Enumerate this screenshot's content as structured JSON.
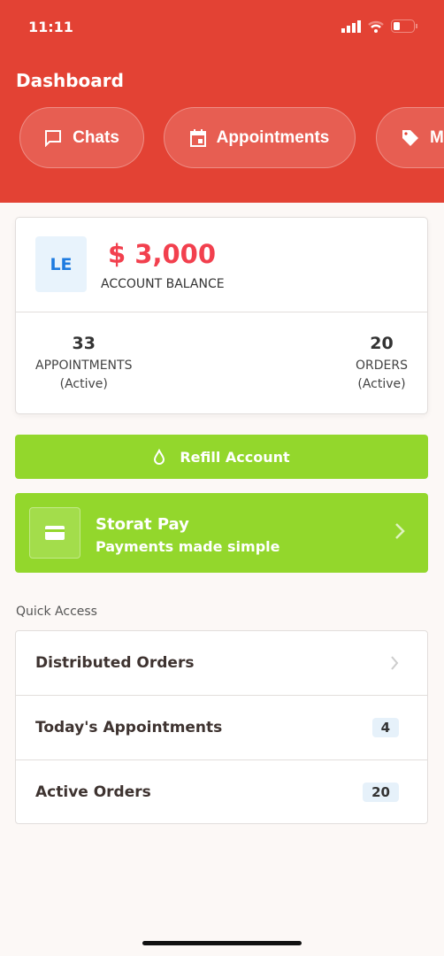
{
  "status_bar": {
    "time": "11:11"
  },
  "header": {
    "title": "Dashboard",
    "pills": [
      {
        "label": "Chats",
        "icon": "chat-icon"
      },
      {
        "label": "Appointments",
        "icon": "calendar-icon"
      },
      {
        "label": "M",
        "icon": "tag-icon"
      }
    ]
  },
  "account": {
    "initials": "LE",
    "balance": "$ 3,000",
    "balance_label": "ACCOUNT BALANCE",
    "appointments": {
      "count": "33",
      "label": "APPOINTMENTS",
      "sub": "(Active)"
    },
    "orders": {
      "count": "20",
      "label": "ORDERS",
      "sub": "(Active)"
    }
  },
  "refill": {
    "label": "Refill Account"
  },
  "pay": {
    "title": "Storat Pay",
    "subtitle": "Payments made simple"
  },
  "quick_access": {
    "title": "Quick Access",
    "items": [
      {
        "label": "Distributed Orders"
      },
      {
        "label": "Today's Appointments",
        "badge": "4"
      },
      {
        "label": "Active Orders",
        "badge": "20"
      }
    ]
  },
  "colors": {
    "header": "#e34234",
    "accent_green": "#93d72c",
    "balance": "#f2404e"
  }
}
